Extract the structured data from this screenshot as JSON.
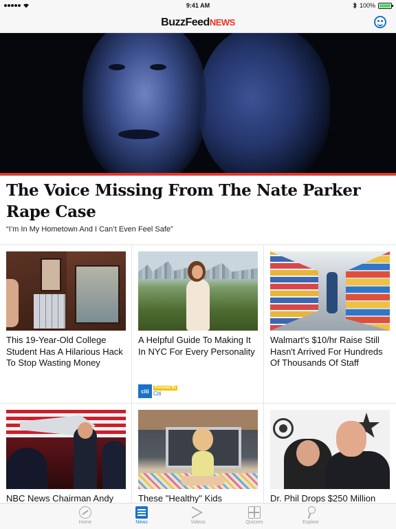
{
  "status_bar": {
    "time": "9:41 AM",
    "battery_percent": "100%",
    "battery_level": 1.0,
    "wifi_icon": "wifi-icon",
    "bluetooth_icon": "bluetooth-icon"
  },
  "header": {
    "logo_buzz": "BuzzFeed",
    "logo_news": "NEWS",
    "emoji_icon": "smiley-face-icon"
  },
  "hero": {
    "title": "The Voice Missing From The Nate Parker Rape Case",
    "subtitle": "“I’m In My Hometown And I Can’t Even Feel Safe”",
    "accent_color": "#e23a2e"
  },
  "articles": [
    {
      "title": "This 19-Year-Old College Student Has A Hilarious Hack To Stop Wasting Money"
    },
    {
      "title": "A Helpful Guide To Making It In NYC For Every Personality",
      "promoted_label": "Promoted By",
      "sponsor": "Citi",
      "sponsor_logo": "citi"
    },
    {
      "title": "Walmart's $10/hr Raise Still Hasn't Arrived For Hundreds Of Thousands Of Staff"
    },
    {
      "title": "NBC News Chairman Andy"
    },
    {
      "title": "These \"Healthy\" Kids"
    },
    {
      "title": "Dr. Phil Drops $250 Million"
    }
  ],
  "tab_bar": {
    "tabs": [
      {
        "label": "Home",
        "icon": "trending-icon"
      },
      {
        "label": "News",
        "icon": "news-icon",
        "active": true
      },
      {
        "label": "Videos",
        "icon": "play-icon"
      },
      {
        "label": "Quizzes",
        "icon": "quiz-grid-icon"
      },
      {
        "label": "Explore",
        "icon": "search-icon"
      }
    ],
    "active_color": "#1a73c8"
  }
}
